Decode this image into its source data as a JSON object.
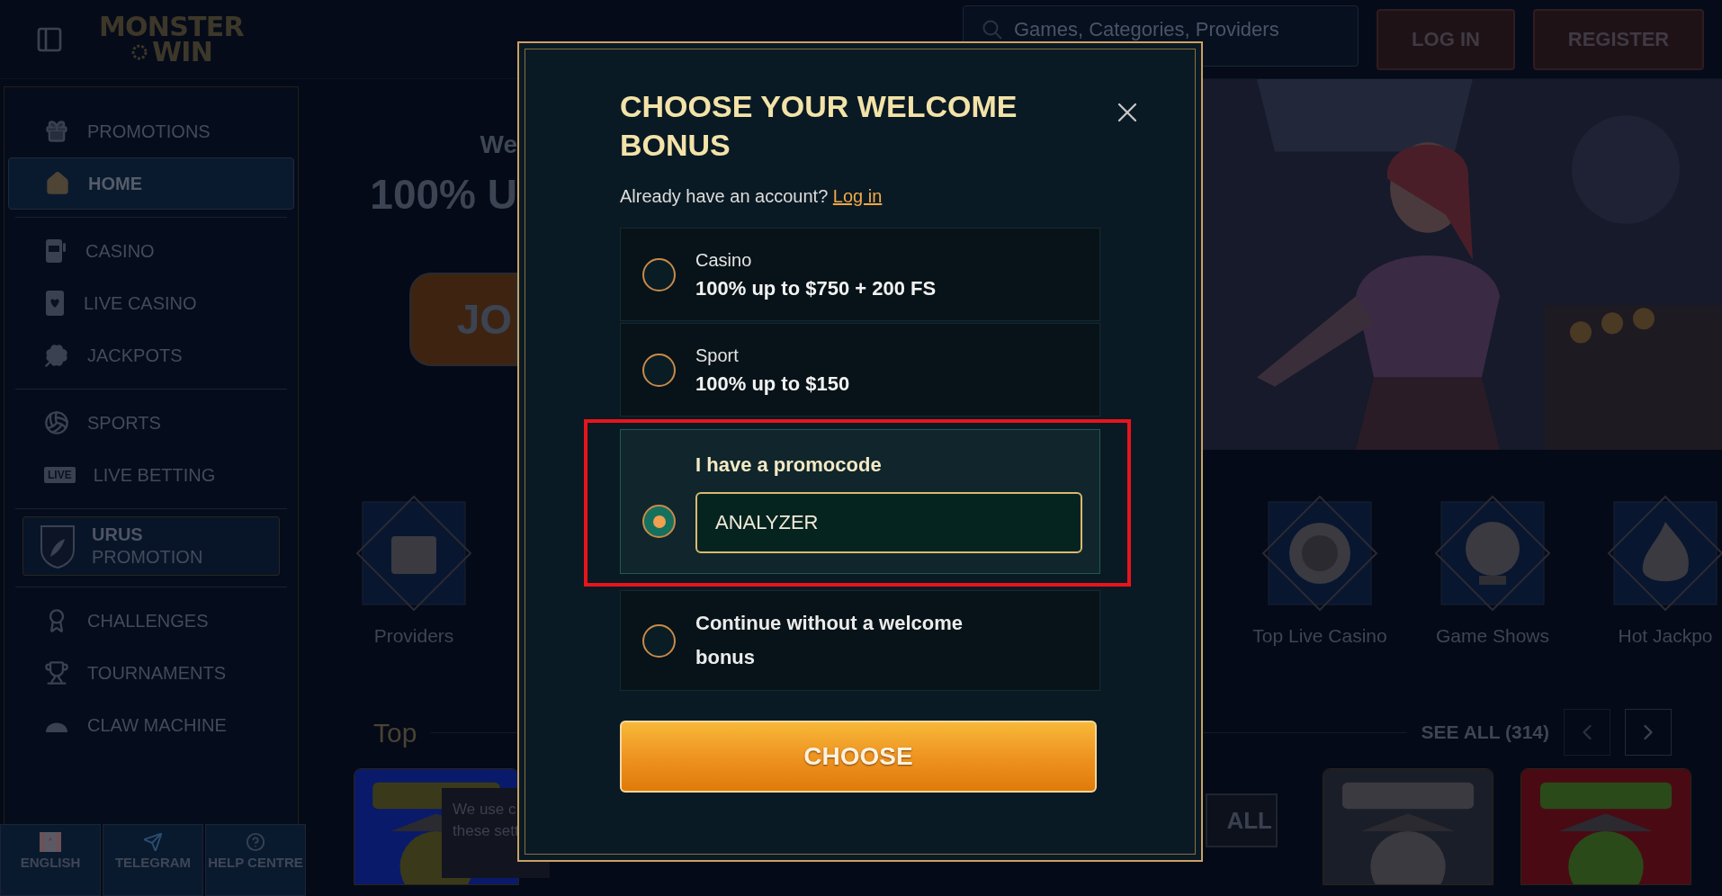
{
  "header": {
    "logo": {
      "line_1": "MONSTER",
      "line_2": "WIN"
    },
    "search": {
      "placeholder": "Games, Categories, Providers"
    },
    "buttons": [
      "LOG IN",
      "REGISTER"
    ]
  },
  "sidebar": {
    "sections": [
      {
        "kind": "menu",
        "items": [
          {
            "label": "PROMOTIONS",
            "selected": false
          },
          {
            "label": "HOME",
            "selected": true
          }
        ]
      },
      {
        "kind": "menu",
        "items": [
          {
            "label": "CASINO",
            "selected": false
          },
          {
            "label": "LIVE CASINO",
            "selected": false
          },
          {
            "label": "JACKPOTS",
            "selected": false
          }
        ]
      },
      {
        "kind": "menu",
        "items": [
          {
            "label": "SPORTS",
            "selected": false
          },
          {
            "label": "LIVE BETTING",
            "badge": "LIVE",
            "selected": false
          }
        ]
      },
      {
        "kind": "promo",
        "title": "URUS",
        "subtitle": "PROMOTION"
      },
      {
        "kind": "menu",
        "items": [
          {
            "label": "CHALLENGES",
            "selected": false
          },
          {
            "label": "TOURNAMENTS",
            "selected": false
          },
          {
            "label": "CLAW MACHINE",
            "selected": false
          }
        ]
      }
    ],
    "footer": [
      "ENGLISH",
      "TELEGRAM",
      "HELP CENTRE"
    ]
  },
  "hero": {
    "eyebrow": "We",
    "headline": "100% U",
    "button": "JO"
  },
  "categories": [
    {
      "label": "Providers"
    },
    {
      "label": "Top Live Casino"
    },
    {
      "label": "Game Shows"
    },
    {
      "label": "Hot Jackpo"
    }
  ],
  "top_games": {
    "title": "Top",
    "see_all": "SEE ALL (314)",
    "show_all_button": "ALL"
  },
  "cookie_notice": {
    "lines": [
      "We use c",
      "these sett"
    ]
  },
  "modal": {
    "title": "CHOOSE YOUR WELCOME BONUS",
    "login_prompt": "Already have an account?",
    "login_link": "Log in",
    "options": [
      {
        "kind": "bonus",
        "name": "Casino",
        "offer": "100% up to $750 + 200 FS",
        "selected": false,
        "highlighted": false
      },
      {
        "kind": "bonus",
        "name": "Sport",
        "offer": "100% up to $150",
        "selected": false,
        "highlighted": false
      },
      {
        "kind": "promocode",
        "label": "I have a promocode",
        "value": "ANALYZER",
        "selected": true,
        "highlighted": true
      },
      {
        "kind": "none",
        "label": "Continue without a welcome bonus",
        "selected": false,
        "highlighted": false
      }
    ],
    "button": "CHOOSE"
  }
}
